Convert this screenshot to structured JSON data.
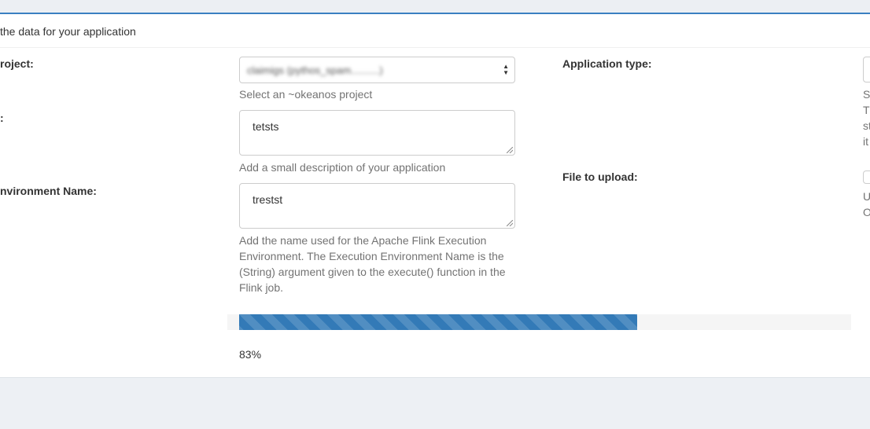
{
  "panel": {
    "title": "the data for your application"
  },
  "form": {
    "project": {
      "label": "roject:",
      "selected_value": "claimigs (pythos_spam..........)",
      "help": "Select an ~okeanos project"
    },
    "description": {
      "label": ":",
      "value": "tetsts",
      "help": "Add a small description of your application"
    },
    "environment": {
      "label": "nvironment Name:",
      "value": "trestst",
      "help": "Add the name used for the Apache Flink Execution Environment. The Execution Environment Name is the (String) argument given to the execute() function in the Flink job."
    },
    "application_type": {
      "label": "Application type:",
      "help_fragments": [
        "S",
        "T",
        "st",
        "it"
      ]
    },
    "file_upload": {
      "label": "File to upload:",
      "help_fragments": [
        "U",
        "O"
      ]
    }
  },
  "progress": {
    "percent": 83,
    "label": "83%"
  },
  "colors": {
    "accent": "#337ab7",
    "panel_border": "#3a7fc1",
    "background": "#edf0f4"
  }
}
